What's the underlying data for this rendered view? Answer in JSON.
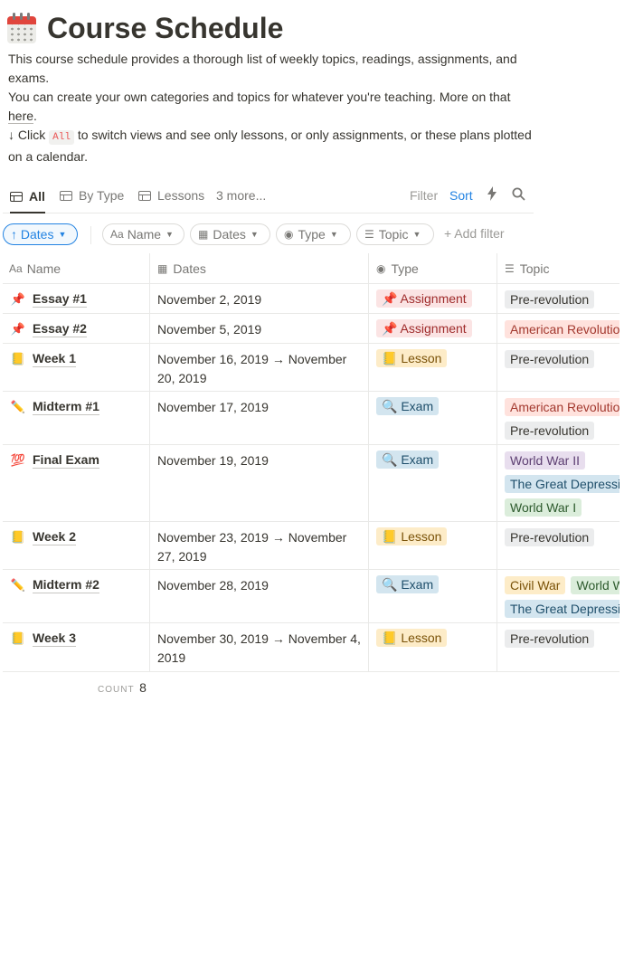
{
  "page": {
    "title": "Course Schedule",
    "description_line1": "This course schedule provides a thorough list of weekly topics, readings, assignments, and exams.",
    "description_line2_pre": "You can create your own categories and topics for whatever you're teaching. More on that ",
    "description_line2_link": "here",
    "description_line2_post": ".",
    "description_line3_pre": "↓ Click ",
    "description_line3_code": "All",
    "description_line3_post": " to switch views and see only lessons, or only assignments, or these plans plotted on a calendar."
  },
  "views": {
    "tabs": [
      "All",
      "By Type",
      "Lessons"
    ],
    "more": "3 more...",
    "filter": "Filter",
    "sort": "Sort"
  },
  "filters": {
    "sort_chip": "↑ Dates",
    "chips": [
      "Name",
      "Dates",
      "Type",
      "Topic"
    ],
    "add_filter": "+ Add filter"
  },
  "table": {
    "headers": {
      "name": "Name",
      "dates": "Dates",
      "type": "Type",
      "topic": "Topic"
    },
    "rows": [
      {
        "icon": "pushpin-icon",
        "name": "Essay #1",
        "dates": "November 2, 2019",
        "type": "📌 Assignment",
        "topics": [
          [
            "Pre-revolution"
          ]
        ]
      },
      {
        "icon": "pushpin-icon",
        "name": "Essay #2",
        "dates": "November 5, 2019",
        "type": "📌 Assignment",
        "topics": [
          [
            "American Revolution"
          ]
        ]
      },
      {
        "icon": "notebook-icon",
        "name": "Week 1",
        "dates": "November 16, 2019 → November 20, 2019",
        "type": "📒 Lesson",
        "topics": [
          [
            "Pre-revolution"
          ]
        ]
      },
      {
        "icon": "pencil-icon",
        "name": "Midterm #1",
        "dates": "November 17, 2019",
        "type": "🔍 Exam",
        "topics": [
          [
            "American Revolution"
          ],
          [
            "Pre-revolution"
          ]
        ]
      },
      {
        "icon": "hundred-icon",
        "name": "Final Exam",
        "dates": "November 19, 2019",
        "type": "🔍 Exam",
        "topics": [
          [
            "World War II"
          ],
          [
            "The Great Depression"
          ],
          [
            "World War I"
          ]
        ]
      },
      {
        "icon": "notebook-icon",
        "name": "Week 2",
        "dates": "November 23, 2019 → November 27, 2019",
        "type": "📒 Lesson",
        "topics": [
          [
            "Pre-revolution"
          ]
        ]
      },
      {
        "icon": "pencil-icon",
        "name": "Midterm #2",
        "dates": "November 28, 2019",
        "type": "🔍 Exam",
        "topics": [
          [
            "Civil War",
            "World War I"
          ],
          [
            "The Great Depression"
          ]
        ]
      },
      {
        "icon": "notebook-icon",
        "name": "Week 3",
        "dates": "November 30, 2019 → November 4, 2019",
        "type": "📒 Lesson",
        "topics": [
          [
            "Pre-revolution"
          ]
        ]
      }
    ],
    "count_label": "COUNT",
    "count_value": "8"
  },
  "colors": {
    "accent": "#2383e2",
    "assignment_bg": "#fbe4e4",
    "lesson_bg": "#fdecc8",
    "exam_bg": "#d3e5ef",
    "pre_revolution_bg": "#ebeced",
    "american_revolution_bg": "#ffe2dd",
    "world_war_ii_bg": "#e8deee",
    "great_depression_bg": "#d3e5ef",
    "world_war_i_bg": "#dbeddb",
    "civil_war_bg": "#fdecc8"
  }
}
